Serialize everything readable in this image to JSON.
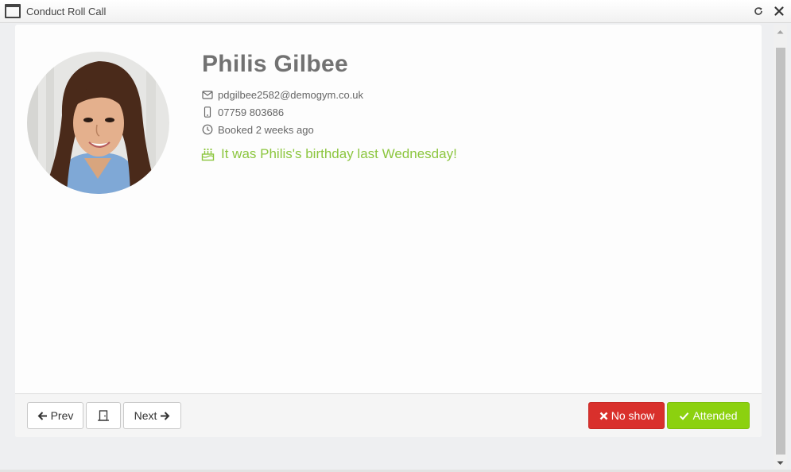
{
  "window": {
    "title": "Conduct Roll Call",
    "icons": {
      "app": "window-icon",
      "refresh": "refresh-icon",
      "close": "close-icon"
    }
  },
  "member": {
    "name": "Philis Gilbee",
    "email": "pdgilbee2582@demogym.co.uk",
    "phone": "07759 803686",
    "booked": "Booked 2 weeks ago",
    "birthday": "It was Philis's birthday last Wednesday!",
    "icons": {
      "photo": "member-photo",
      "email": "envelope-icon",
      "phone": "mobile-phone-icon",
      "booked": "clock-icon",
      "birthday": "birthday-cake-icon"
    }
  },
  "footer": {
    "prev_label": "Prev",
    "next_label": "Next",
    "no_show_label": "No show",
    "attended_label": "Attended",
    "icons": {
      "prev": "arrow-left-icon",
      "door": "door-exit-icon",
      "next": "arrow-right-icon",
      "no_show": "times-icon",
      "attended": "check-icon"
    }
  },
  "colors": {
    "birthday_text": "#8cc63f",
    "no_show_button": "#d9302c",
    "attended_button": "#8cd10f",
    "name_text": "#727272"
  }
}
